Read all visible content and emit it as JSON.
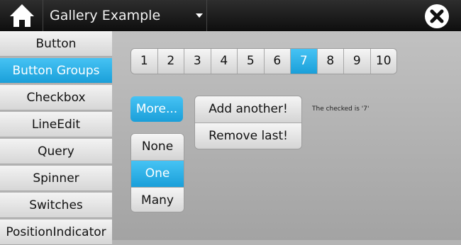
{
  "header": {
    "title": "Gallery Example",
    "icons": {
      "home": "home-icon",
      "dropdown": "chevron-down-icon",
      "close": "close-icon"
    }
  },
  "sidebar": {
    "items": [
      {
        "label": "Button"
      },
      {
        "label": "Button Groups",
        "active": true
      },
      {
        "label": "Checkbox"
      },
      {
        "label": "LineEdit"
      },
      {
        "label": "Query"
      },
      {
        "label": "Spinner"
      },
      {
        "label": "Switches"
      },
      {
        "label": "PositionIndicator"
      }
    ]
  },
  "main": {
    "numbers": [
      "1",
      "2",
      "3",
      "4",
      "5",
      "6",
      "7",
      "8",
      "9",
      "10"
    ],
    "numbers_selected": "7",
    "more_label": "More...",
    "vertical_group": [
      "None",
      "One",
      "Many"
    ],
    "vertical_selected": "One",
    "add_label": "Add another!",
    "remove_label": "Remove last!",
    "status_text": "The checked is '7'"
  },
  "colors": {
    "accent": "#1a9fd9",
    "titlebar": "#0e0e0e",
    "background": "#b4b4b4"
  }
}
